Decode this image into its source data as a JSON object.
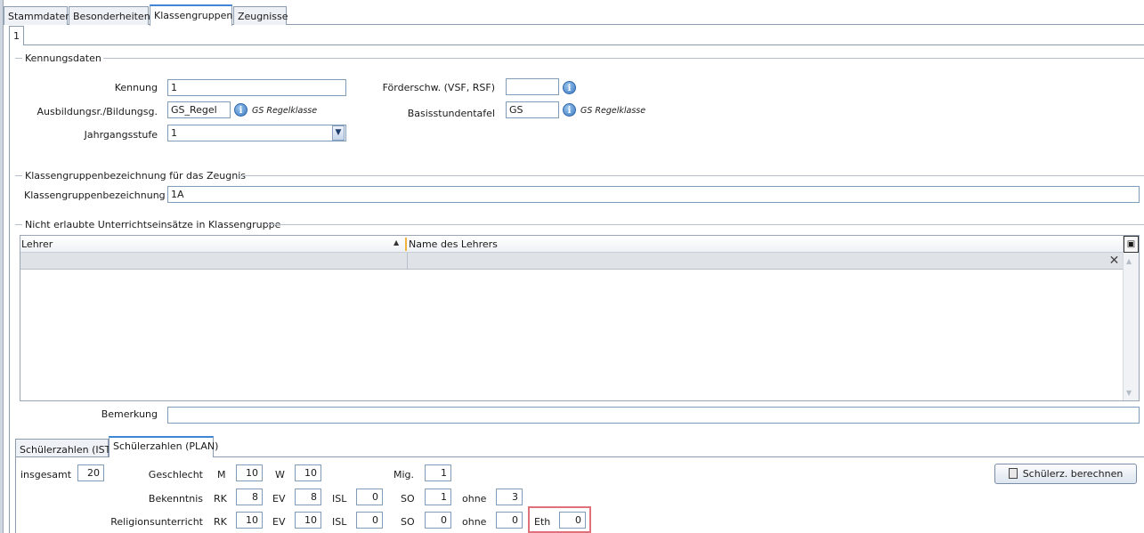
{
  "tabs": [
    "Stammdaten",
    "Besonderheiten",
    "Klassengruppen",
    "Zeugnisse"
  ],
  "active_tab": "Klassengruppen",
  "subtab": "1",
  "kennung": {
    "legend": "Kennungsdaten",
    "kennung_label": "Kennung",
    "kennung_value": "1",
    "ausbildung_label": "Ausbildungsr./Bildungsg.",
    "ausbildung_value": "GS_Regel",
    "ausbildung_hint": "GS Regelklasse",
    "jahrgang_label": "Jahrgangsstufe",
    "jahrgang_value": "1",
    "foerder_label": "Förderschw. (VSF, RSF)",
    "foerder_value": "",
    "basis_label": "Basisstundentafel",
    "basis_value": "GS",
    "basis_hint": "GS Regelklasse"
  },
  "bezeichnung": {
    "legend": "Klassengruppenbezeichnung für das Zeugnis",
    "label": "Klassengruppenbezeichnung",
    "value": "1A"
  },
  "einsaetze": {
    "legend": "Nicht erlaubte Unterrichtseinsätze in Klassengruppe",
    "columns": [
      "Lehrer",
      "Name des Lehrers"
    ]
  },
  "bemerkung": {
    "label": "Bemerkung",
    "value": ""
  },
  "schueler_tabs": [
    "Schülerzahlen (IST)",
    "Schülerzahlen (PLAN)"
  ],
  "schueler_active": "Schülerzahlen (PLAN)",
  "schueler": {
    "insgesamt_label": "insgesamt",
    "insgesamt": "20",
    "geschlecht_label": "Geschlecht",
    "m_label": "M",
    "m": "10",
    "w_label": "W",
    "w": "10",
    "mig_label": "Mig.",
    "mig": "1",
    "bekenntnis_label": "Bekenntnis",
    "bek_rk_label": "RK",
    "bek_rk": "8",
    "bek_ev_label": "EV",
    "bek_ev": "8",
    "bek_isl_label": "ISL",
    "bek_isl": "0",
    "bek_so_label": "SO",
    "bek_so": "1",
    "bek_ohne_label": "ohne",
    "bek_ohne": "3",
    "religion_label": "Religionsunterricht",
    "rel_rk_label": "RK",
    "rel_rk": "10",
    "rel_ev_label": "EV",
    "rel_ev": "10",
    "rel_isl_label": "ISL",
    "rel_isl": "0",
    "rel_so_label": "SO",
    "rel_so": "0",
    "rel_ohne_label": "ohne",
    "rel_ohne": "0",
    "rel_eth_label": "Eth",
    "rel_eth": "0",
    "berechnen_label": "Schülerz. berechnen"
  },
  "colors": {
    "accent": "#3f86d4",
    "highlight": "#e0707a"
  }
}
